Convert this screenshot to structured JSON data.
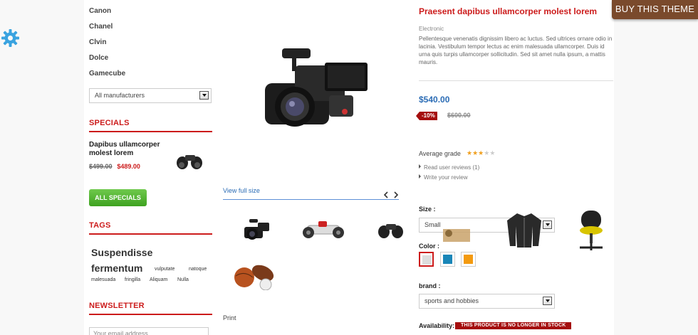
{
  "top_button": {
    "label": "BUY THIS THEME"
  },
  "sidebar": {
    "manufacturers": [
      "Canon",
      "Chanel",
      "Clvin",
      "Dolce",
      "Gamecube"
    ],
    "manufacturer_select": "All manufacturers",
    "specials": {
      "heading": "SPECIALS",
      "product_name": "Dapibus ullamcorper molest lorem",
      "old_price": "$499.00",
      "new_price": "$489.00",
      "button": "ALL SPECIALS"
    },
    "tags": {
      "heading": "TAGS",
      "items": [
        "Suspendisse",
        "fermentum",
        "vulputate",
        "natoque",
        "malesuada",
        "fringilla",
        "Aliquam",
        "Nulla"
      ]
    },
    "newsletter": {
      "heading": "NEWSLETTER",
      "placeholder": "Your email address"
    }
  },
  "gallery": {
    "view_full": "View full size",
    "print": "Print"
  },
  "product": {
    "title": "Praesent dapibus ullamcorper molest lorem",
    "category": "Electronic",
    "description": "Pellentesque venenatis dignissim libero ac luctus. Sed ultrices ornare odio in lacinia. Vestibulum tempor lectus ac enim malesuada ullamcorper. Duis id urna quis turpis ullamcorper sollicitudin. Sed sit amet nulla ipsum, a mattis mauris.",
    "price": "$540.00",
    "discount": "-10%",
    "old_price": "$600.00",
    "grade_label": "Average grade",
    "rating": 3,
    "rating_max": 5,
    "read_reviews": "Read user reviews (1)",
    "write_review": "Write your review",
    "size_label": "Size :",
    "size_value": "Small",
    "color_label": "Color :",
    "colors": [
      "#dddddd",
      "#1a86b8",
      "#f39a10"
    ],
    "brand_label": "brand :",
    "brand_value": "sports and hobbies",
    "availability_label": "Availability:",
    "availability_value": "THIS PRODUCT IS NO LONGER IN STOCK"
  },
  "colors": {
    "accent": "#cc1b1b",
    "link": "#2b6cb5",
    "brand_button": "#7a4a2c",
    "green_button": "#3ea21f"
  }
}
